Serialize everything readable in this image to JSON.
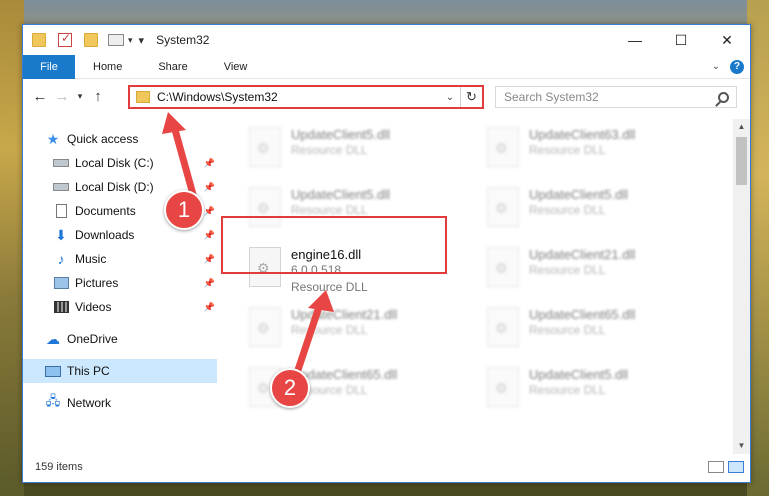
{
  "window": {
    "title": "System32"
  },
  "ribbon": {
    "tabs": [
      "File",
      "Home",
      "Share",
      "View"
    ]
  },
  "address": {
    "path": "C:\\Windows\\System32"
  },
  "search": {
    "placeholder": "Search System32"
  },
  "nav": {
    "items": [
      {
        "label": "Quick access",
        "icon": "star-icon"
      },
      {
        "label": "Local Disk (C:)",
        "icon": "drive-icon"
      },
      {
        "label": "Local Disk (D:)",
        "icon": "drive-icon"
      },
      {
        "label": "Documents",
        "icon": "documents-icon"
      },
      {
        "label": "Downloads",
        "icon": "downloads-icon"
      },
      {
        "label": "Music",
        "icon": "music-icon"
      },
      {
        "label": "Pictures",
        "icon": "pictures-icon"
      },
      {
        "label": "Videos",
        "icon": "videos-icon"
      },
      {
        "label": "OneDrive",
        "icon": "cloud-icon"
      },
      {
        "label": "This PC",
        "icon": "computer-icon"
      },
      {
        "label": "Network",
        "icon": "network-icon"
      }
    ]
  },
  "files": [
    {
      "name": "UpdateClient5.dll",
      "meta": "Resource DLL"
    },
    {
      "name": "UpdateClient63.dll",
      "meta": "Resource DLL"
    },
    {
      "name": "UpdateClient5.dll",
      "meta": "Resource DLL"
    },
    {
      "name": "UpdateClient5.dll",
      "meta": "Resource DLL"
    },
    {
      "name": "engine16.dll",
      "version": "6.0.0.518",
      "meta": "Resource DLL"
    },
    {
      "name": "UpdateClient21.dll",
      "meta": "Resource DLL"
    },
    {
      "name": "UpdateClient21.dll",
      "meta": "Resource DLL"
    },
    {
      "name": "UpdateClient65.dll",
      "meta": "Resource DLL"
    },
    {
      "name": "UpdateClient65.dll",
      "meta": "Resource DLL"
    },
    {
      "name": "UpdateClient5.dll",
      "meta": "Resource DLL"
    }
  ],
  "status": {
    "items": "159 items"
  },
  "annotations": {
    "step1": "1",
    "step2": "2"
  },
  "colors": {
    "accent": "#1979ca",
    "highlight": "#e23b3b",
    "selected": "#cce8ff"
  }
}
